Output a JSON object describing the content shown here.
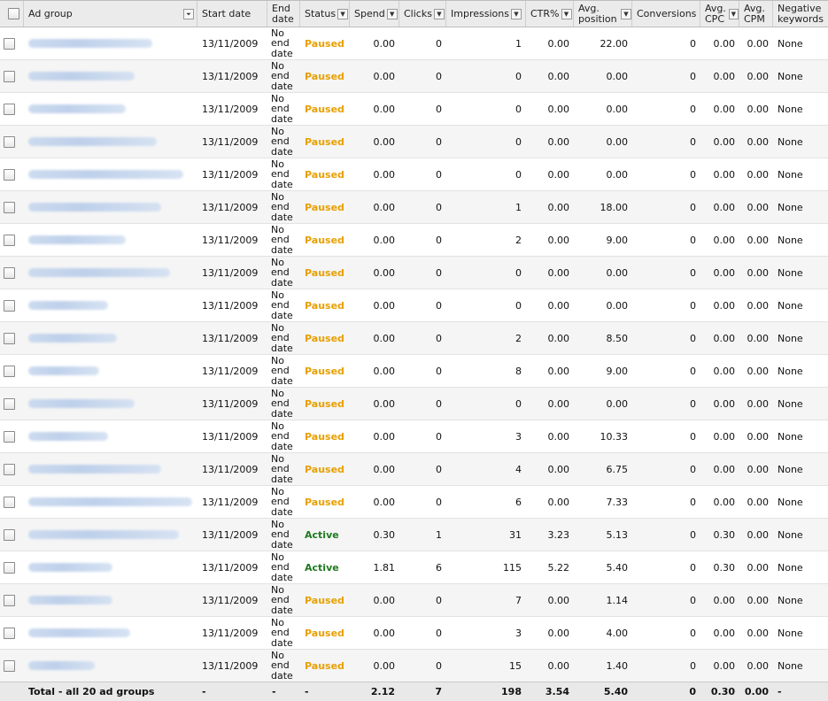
{
  "header": {
    "ad_group": "Ad group",
    "start_date": "Start date",
    "end_date": "End date",
    "status": "Status",
    "spend": "Spend",
    "clicks": "Clicks",
    "impressions": "Impressions",
    "ctr": "CTR%",
    "avg_position": "Avg. position",
    "conversions": "Conversions",
    "avg_cpc": "Avg. CPC",
    "avg_cpm": "Avg. CPM",
    "negative_keywords": "Negative keywords"
  },
  "colors": {
    "paused": "#e8a000",
    "active": "#1f7a1f",
    "header_bg": "#ebebeb",
    "alt_row_bg": "#f5f5f5"
  },
  "rows": [
    {
      "start": "13/11/2009",
      "end": "No end date",
      "status": "Paused",
      "spend": "0.00",
      "clicks": "0",
      "impressions": "1",
      "ctr": "0.00",
      "pos": "22.00",
      "conv": "0",
      "cpc": "0.00",
      "cpm": "0.00",
      "neg": "None"
    },
    {
      "start": "13/11/2009",
      "end": "No end date",
      "status": "Paused",
      "spend": "0.00",
      "clicks": "0",
      "impressions": "0",
      "ctr": "0.00",
      "pos": "0.00",
      "conv": "0",
      "cpc": "0.00",
      "cpm": "0.00",
      "neg": "None"
    },
    {
      "start": "13/11/2009",
      "end": "No end date",
      "status": "Paused",
      "spend": "0.00",
      "clicks": "0",
      "impressions": "0",
      "ctr": "0.00",
      "pos": "0.00",
      "conv": "0",
      "cpc": "0.00",
      "cpm": "0.00",
      "neg": "None"
    },
    {
      "start": "13/11/2009",
      "end": "No end date",
      "status": "Paused",
      "spend": "0.00",
      "clicks": "0",
      "impressions": "0",
      "ctr": "0.00",
      "pos": "0.00",
      "conv": "0",
      "cpc": "0.00",
      "cpm": "0.00",
      "neg": "None"
    },
    {
      "start": "13/11/2009",
      "end": "No end date",
      "status": "Paused",
      "spend": "0.00",
      "clicks": "0",
      "impressions": "0",
      "ctr": "0.00",
      "pos": "0.00",
      "conv": "0",
      "cpc": "0.00",
      "cpm": "0.00",
      "neg": "None"
    },
    {
      "start": "13/11/2009",
      "end": "No end date",
      "status": "Paused",
      "spend": "0.00",
      "clicks": "0",
      "impressions": "1",
      "ctr": "0.00",
      "pos": "18.00",
      "conv": "0",
      "cpc": "0.00",
      "cpm": "0.00",
      "neg": "None"
    },
    {
      "start": "13/11/2009",
      "end": "No end date",
      "status": "Paused",
      "spend": "0.00",
      "clicks": "0",
      "impressions": "2",
      "ctr": "0.00",
      "pos": "9.00",
      "conv": "0",
      "cpc": "0.00",
      "cpm": "0.00",
      "neg": "None"
    },
    {
      "start": "13/11/2009",
      "end": "No end date",
      "status": "Paused",
      "spend": "0.00",
      "clicks": "0",
      "impressions": "0",
      "ctr": "0.00",
      "pos": "0.00",
      "conv": "0",
      "cpc": "0.00",
      "cpm": "0.00",
      "neg": "None"
    },
    {
      "start": "13/11/2009",
      "end": "No end date",
      "status": "Paused",
      "spend": "0.00",
      "clicks": "0",
      "impressions": "0",
      "ctr": "0.00",
      "pos": "0.00",
      "conv": "0",
      "cpc": "0.00",
      "cpm": "0.00",
      "neg": "None"
    },
    {
      "start": "13/11/2009",
      "end": "No end date",
      "status": "Paused",
      "spend": "0.00",
      "clicks": "0",
      "impressions": "2",
      "ctr": "0.00",
      "pos": "8.50",
      "conv": "0",
      "cpc": "0.00",
      "cpm": "0.00",
      "neg": "None"
    },
    {
      "start": "13/11/2009",
      "end": "No end date",
      "status": "Paused",
      "spend": "0.00",
      "clicks": "0",
      "impressions": "8",
      "ctr": "0.00",
      "pos": "9.00",
      "conv": "0",
      "cpc": "0.00",
      "cpm": "0.00",
      "neg": "None"
    },
    {
      "start": "13/11/2009",
      "end": "No end date",
      "status": "Paused",
      "spend": "0.00",
      "clicks": "0",
      "impressions": "0",
      "ctr": "0.00",
      "pos": "0.00",
      "conv": "0",
      "cpc": "0.00",
      "cpm": "0.00",
      "neg": "None"
    },
    {
      "start": "13/11/2009",
      "end": "No end date",
      "status": "Paused",
      "spend": "0.00",
      "clicks": "0",
      "impressions": "3",
      "ctr": "0.00",
      "pos": "10.33",
      "conv": "0",
      "cpc": "0.00",
      "cpm": "0.00",
      "neg": "None"
    },
    {
      "start": "13/11/2009",
      "end": "No end date",
      "status": "Paused",
      "spend": "0.00",
      "clicks": "0",
      "impressions": "4",
      "ctr": "0.00",
      "pos": "6.75",
      "conv": "0",
      "cpc": "0.00",
      "cpm": "0.00",
      "neg": "None"
    },
    {
      "start": "13/11/2009",
      "end": "No end date",
      "status": "Paused",
      "spend": "0.00",
      "clicks": "0",
      "impressions": "6",
      "ctr": "0.00",
      "pos": "7.33",
      "conv": "0",
      "cpc": "0.00",
      "cpm": "0.00",
      "neg": "None"
    },
    {
      "start": "13/11/2009",
      "end": "No end date",
      "status": "Active",
      "spend": "0.30",
      "clicks": "1",
      "impressions": "31",
      "ctr": "3.23",
      "pos": "5.13",
      "conv": "0",
      "cpc": "0.30",
      "cpm": "0.00",
      "neg": "None"
    },
    {
      "start": "13/11/2009",
      "end": "No end date",
      "status": "Active",
      "spend": "1.81",
      "clicks": "6",
      "impressions": "115",
      "ctr": "5.22",
      "pos": "5.40",
      "conv": "0",
      "cpc": "0.30",
      "cpm": "0.00",
      "neg": "None"
    },
    {
      "start": "13/11/2009",
      "end": "No end date",
      "status": "Paused",
      "spend": "0.00",
      "clicks": "0",
      "impressions": "7",
      "ctr": "0.00",
      "pos": "1.14",
      "conv": "0",
      "cpc": "0.00",
      "cpm": "0.00",
      "neg": "None"
    },
    {
      "start": "13/11/2009",
      "end": "No end date",
      "status": "Paused",
      "spend": "0.00",
      "clicks": "0",
      "impressions": "3",
      "ctr": "0.00",
      "pos": "4.00",
      "conv": "0",
      "cpc": "0.00",
      "cpm": "0.00",
      "neg": "None"
    },
    {
      "start": "13/11/2009",
      "end": "No end date",
      "status": "Paused",
      "spend": "0.00",
      "clicks": "0",
      "impressions": "15",
      "ctr": "0.00",
      "pos": "1.40",
      "conv": "0",
      "cpc": "0.00",
      "cpm": "0.00",
      "neg": "None"
    }
  ],
  "total": {
    "label": "Total - all 20 ad groups",
    "start": "-",
    "end": "-",
    "status": "-",
    "spend": "2.12",
    "clicks": "7",
    "impressions": "198",
    "ctr": "3.54",
    "pos": "5.40",
    "conv": "0",
    "cpc": "0.30",
    "cpm": "0.00",
    "neg": "-"
  }
}
